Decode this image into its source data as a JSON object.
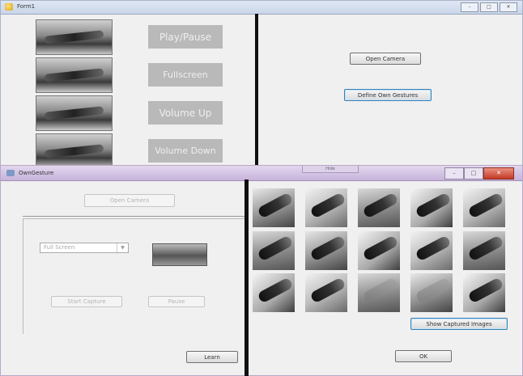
{
  "form1": {
    "title": "Form1",
    "gesture_buttons": [
      {
        "label": "Play/Pause"
      },
      {
        "label": "Fullscreen"
      },
      {
        "label": "Volume Up"
      },
      {
        "label": "Volume Down"
      }
    ],
    "open_camera_label": "Open Camera",
    "define_gestures_label": "Define Own Gestures"
  },
  "dialog": {
    "title": "OwnGesture",
    "tab_label": "Hide",
    "open_camera_label": "Open Camera",
    "combo_value": "Full Screen",
    "start_capture_label": "Start Capture",
    "pause_label": "Pause",
    "learn_label": "Learn",
    "show_captured_label": "Show Captured Images",
    "ok_label": "OK"
  },
  "icons": {
    "window": "window-icon",
    "minimize": "minimize-icon",
    "maximize": "maximize-icon",
    "close": "close-icon",
    "dropdown": "chevron-down-icon"
  },
  "colors": {
    "title1": "#c9d6ea",
    "title2": "#c7b3dc",
    "gray_button": "#b9b9b9",
    "close": "#c43a26"
  }
}
